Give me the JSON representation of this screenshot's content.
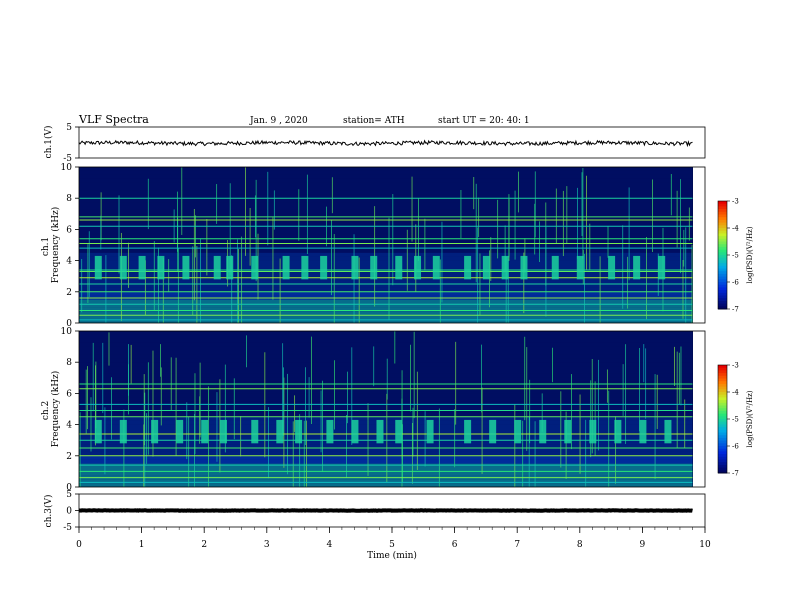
{
  "header": {
    "title": "VLF  Spectra",
    "date": "Jan.  9  , 2020",
    "station": "station= ATH",
    "start_ut": "start  UT  =   20: 40: 1"
  },
  "chart_data": [
    {
      "type": "line",
      "name": "ch1-waveform",
      "ylabel": "ch.1(V)",
      "ylim": [
        -5,
        5
      ],
      "yticks": [
        "5",
        "-5"
      ],
      "xlim": [
        0,
        10
      ],
      "level_v": -0.2,
      "amplitude_v": 0.6
    },
    {
      "type": "heatmap",
      "name": "ch1-spectrogram",
      "ylabel": "ch.1\nFrequency (kHz)",
      "ylim": [
        0,
        10
      ],
      "yticks": [
        "10",
        "8",
        "6",
        "4",
        "2",
        "0"
      ],
      "xlim": [
        0,
        9.8
      ],
      "colorbar": {
        "label": "log(PSD)(V²/Hz)",
        "ticks": [
          "-3",
          "-4",
          "-5",
          "-6",
          "-7"
        ],
        "range": [
          -7,
          -3
        ]
      },
      "bright_lines_khz": [
        0.2,
        0.5,
        0.8,
        1.2,
        1.6,
        2.0,
        2.5,
        2.9,
        3.3,
        3.4,
        4.8,
        5.1,
        5.4,
        6.2,
        6.6,
        6.8,
        8.0
      ],
      "burst_band_khz": [
        2.8,
        4.3
      ],
      "burst_times_min": [
        0.3,
        0.7,
        1.0,
        1.3,
        1.7,
        2.2,
        2.4,
        2.8,
        3.3,
        3.6,
        3.9,
        4.4,
        4.7,
        5.1,
        5.4,
        5.7,
        6.2,
        6.5,
        6.8,
        7.1,
        7.6,
        8.0,
        8.5,
        8.9,
        9.3
      ]
    },
    {
      "type": "heatmap",
      "name": "ch2-spectrogram",
      "ylabel": "ch.2\nFrequency (kHz)",
      "ylim": [
        0,
        10
      ],
      "yticks": [
        "10",
        "8",
        "6",
        "4",
        "2",
        "0"
      ],
      "xlim": [
        0,
        9.8
      ],
      "colorbar": {
        "label": "log(PSD)(V²/Hz)",
        "ticks": [
          "-3",
          "-4",
          "-5",
          "-6",
          "-7"
        ],
        "range": [
          -7,
          -3
        ]
      },
      "bright_lines_khz": [
        0.3,
        0.6,
        1.0,
        1.4,
        2.0,
        2.5,
        3.0,
        3.4,
        4.5,
        4.9,
        5.3,
        6.3,
        6.6
      ],
      "burst_band_khz": [
        2.8,
        4.3
      ],
      "burst_times_min": [
        0.3,
        0.7,
        1.2,
        1.6,
        2.0,
        2.3,
        2.8,
        3.2,
        3.5,
        4.0,
        4.4,
        4.8,
        5.1,
        5.6,
        6.2,
        6.6,
        7.0,
        7.4,
        7.8,
        8.2,
        8.6,
        9.0,
        9.4
      ]
    },
    {
      "type": "line",
      "name": "ch3-waveform",
      "ylabel": "ch.3(V)",
      "ylim": [
        -5,
        5
      ],
      "yticks": [
        "5",
        "0",
        "-5"
      ],
      "xlim": [
        0,
        10
      ],
      "level_v": 0,
      "amplitude_v": 0.05
    }
  ],
  "x_axis": {
    "label": "Time  (min)",
    "ticks": [
      "0",
      "1",
      "2",
      "3",
      "4",
      "5",
      "6",
      "7",
      "8",
      "9",
      "10"
    ],
    "range": [
      0,
      10
    ]
  },
  "colors": {
    "background": "#ffffff",
    "axis": "#000000"
  }
}
